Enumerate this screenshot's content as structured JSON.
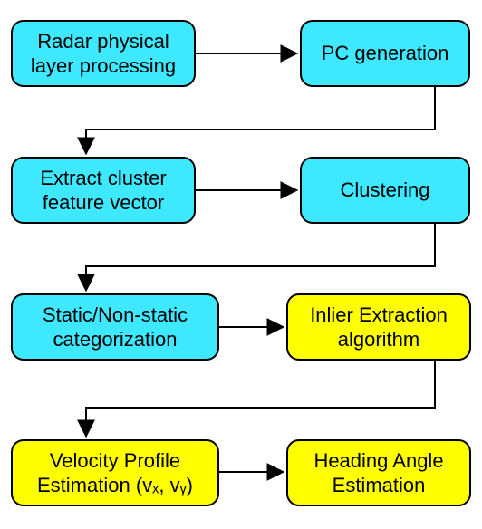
{
  "nodes": {
    "radar": {
      "label": "Radar physical layer processing",
      "color": "cyan"
    },
    "pcgen": {
      "label": "PC generation",
      "color": "cyan"
    },
    "extract": {
      "label": "Extract cluster feature vector",
      "color": "cyan"
    },
    "cluster": {
      "label": "Clustering",
      "color": "cyan"
    },
    "static": {
      "label": "Static/Non-static categorization",
      "color": "cyan"
    },
    "inlier": {
      "label": "Inlier Extraction algorithm",
      "color": "yellow"
    },
    "velocity": {
      "label": "Velocity Profile Estimation (vₓ, vᵧ)",
      "color": "yellow"
    },
    "heading": {
      "label": "Heading Angle Estimation",
      "color": "yellow"
    }
  },
  "edges": [
    [
      "radar",
      "pcgen"
    ],
    [
      "pcgen",
      "extract"
    ],
    [
      "extract",
      "cluster"
    ],
    [
      "cluster",
      "static"
    ],
    [
      "static",
      "inlier"
    ],
    [
      "inlier",
      "velocity"
    ],
    [
      "velocity",
      "heading"
    ]
  ]
}
